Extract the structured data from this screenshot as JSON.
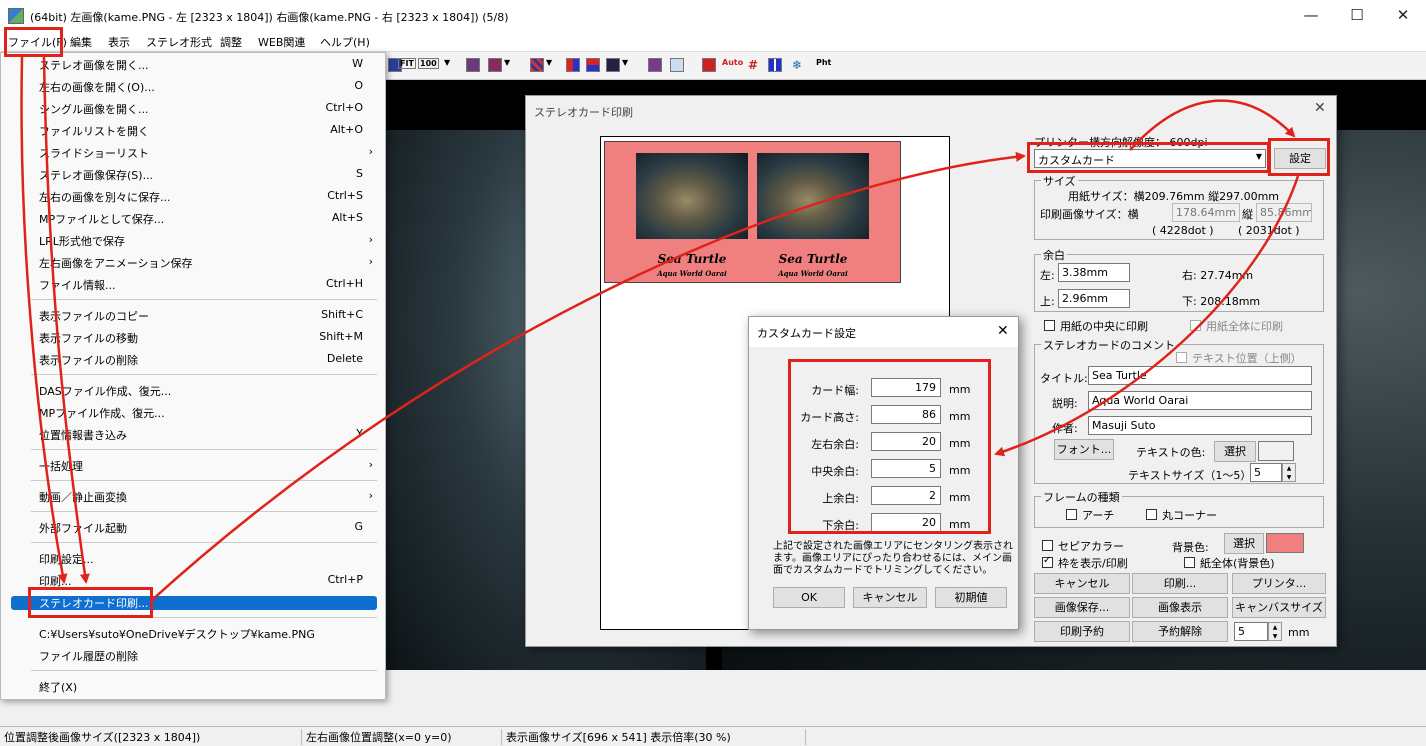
{
  "window": {
    "title": "(64bit) 左画像(kame.PNG - 左 [2323 x 1804]) 右画像(kame.PNG - 右 [2323 x 1804])  (5/8)",
    "minimize": "—",
    "maximize": "☐",
    "close": "✕"
  },
  "menubar": [
    "ファイル(F)",
    "編集",
    "表示",
    "ステレオ形式",
    "調整",
    "WEB関連",
    "ヘルプ(H)"
  ],
  "toolbar": {
    "fit": "FIT",
    "zoom": "100",
    "auto": "Auto",
    "pht": "Pht"
  },
  "file_menu": {
    "items": [
      {
        "label": "ステレオ画像を開く...",
        "key": "W"
      },
      {
        "label": "左右の画像を開く(O)...",
        "key": "O"
      },
      {
        "label": "シングル画像を開く...",
        "key": "Ctrl+O"
      },
      {
        "label": "ファイルリストを開く",
        "key": "Alt+O"
      },
      {
        "label": "スライドショーリスト",
        "key": "›"
      },
      {
        "label": "ステレオ画像保存(S)...",
        "key": "S"
      },
      {
        "label": "左右の画像を別々に保存...",
        "key": "Ctrl+S"
      },
      {
        "label": "MPファイルとして保存...",
        "key": "Alt+S"
      },
      {
        "label": "LRL形式他で保存",
        "key": "›"
      },
      {
        "label": "左右画像をアニメーション保存",
        "key": "›"
      },
      {
        "label": "ファイル情報...",
        "key": "Ctrl+H"
      },
      {
        "label": "表示ファイルのコピー",
        "key": "Shift+C"
      },
      {
        "label": "表示ファイルの移動",
        "key": "Shift+M"
      },
      {
        "label": "表示ファイルの削除",
        "key": "Delete"
      },
      {
        "label": "DASファイル作成、復元...",
        "key": ""
      },
      {
        "label": "MPファイル作成、復元...",
        "key": ""
      },
      {
        "label": "位置情報書き込み",
        "key": "Y"
      },
      {
        "label": "一括処理",
        "key": "›"
      },
      {
        "label": "動画／静止画変換",
        "key": "›"
      },
      {
        "label": "外部ファイル起動",
        "key": "G"
      },
      {
        "label": "印刷設定...",
        "key": ""
      },
      {
        "label": "印刷...",
        "key": "Ctrl+P"
      },
      {
        "label": "ステレオカード印刷...",
        "key": ""
      },
      {
        "label": "C:¥Users¥suto¥OneDrive¥デスクトップ¥kame.PNG",
        "key": ""
      },
      {
        "label": "ファイル履歴の削除",
        "key": ""
      },
      {
        "label": "終了(X)",
        "key": ""
      }
    ]
  },
  "stereo_dialog": {
    "title": "ステレオカード印刷",
    "close": "✕",
    "preview": {
      "card_title": "Sea Turtle",
      "card_sub": "Aqua World Oarai"
    },
    "printer_res_label": "プリンター横方向解像度：  600dpi",
    "paper_select": "カスタムカード",
    "settings_button": "設定",
    "size_group": "サイズ",
    "paper_size": "用紙サイズ：横209.76mm 縦297.00mm",
    "print_size_label": "印刷画像サイズ：横",
    "print_w": "178.64mm",
    "print_h_label": "縦",
    "print_h": "85.86mm",
    "print_w_dot": "( 4228dot )",
    "print_h_dot": "( 2031dot )",
    "margin_group": "余白",
    "left_label": "左:",
    "left_val": "3.38mm",
    "right_label": "右: 27.74mm",
    "top_label": "上:",
    "top_val": "2.96mm",
    "bottom_label": "下: 208.18mm",
    "center_chk": "用紙の中央に印刷",
    "full_chk": "用紙全体に印刷",
    "comment_group": "ステレオカードのコメント",
    "text_pos_chk": "テキスト位置（上側）",
    "title_label": "タイトル:",
    "title_val": "Sea Turtle",
    "desc_label": "説明:",
    "desc_val": "Aqua World Oarai",
    "author_label": "作者:",
    "author_val": "Masuji Suto",
    "font_button": "フォント...",
    "text_color_label": "テキストの色:",
    "select_button": "選択",
    "text_color": "#000000",
    "text_size_label": "テキストサイズ（1～5）:",
    "text_size": "5",
    "frame_group": "フレームの種類",
    "arch_chk": "アーチ",
    "round_chk": "丸コーナー",
    "sepia_chk": "セピアカラー",
    "bg_label": "背景色:",
    "bg_select": "選択",
    "bg_color": "#f08080",
    "frame_chk": "枠を表示/印刷",
    "paper_bg_chk": "紙全体(背景色)",
    "buttons": [
      "キャンセル",
      "印刷...",
      "プリンタ...",
      "画像保存...",
      "画像表示",
      "キャンバスサイズ",
      "印刷予約",
      "予約解除"
    ],
    "gap_val": "5",
    "gap_unit": "mm"
  },
  "custom_dialog": {
    "title": "カスタムカード設定",
    "close": "✕",
    "fields": [
      {
        "label": "カード幅:",
        "value": "179",
        "unit": "mm"
      },
      {
        "label": "カード高さ:",
        "value": "86",
        "unit": "mm"
      },
      {
        "label": "左右余白:",
        "value": "20",
        "unit": "mm"
      },
      {
        "label": "中央余白:",
        "value": "5",
        "unit": "mm"
      },
      {
        "label": "上余白:",
        "value": "2",
        "unit": "mm"
      },
      {
        "label": "下余白:",
        "value": "20",
        "unit": "mm"
      }
    ],
    "note": "上記で設定された画像エリアにセンタリング表示されます。画像エリアにぴったり合わせるには、メイン画面でカスタムカードでトリミングしてください。",
    "ok": "OK",
    "cancel": "キャンセル",
    "reset": "初期値"
  },
  "status": [
    "位置調整後画像サイズ([2323 x 1804])",
    "左右画像位置調整(x=0 y=0)",
    "表示画像サイズ[696 x 541]  表示倍率(30 %)"
  ],
  "colors": {
    "highlight": "#0f6fd1",
    "annotation": "#e0231a",
    "card_bg": "#f08080"
  }
}
